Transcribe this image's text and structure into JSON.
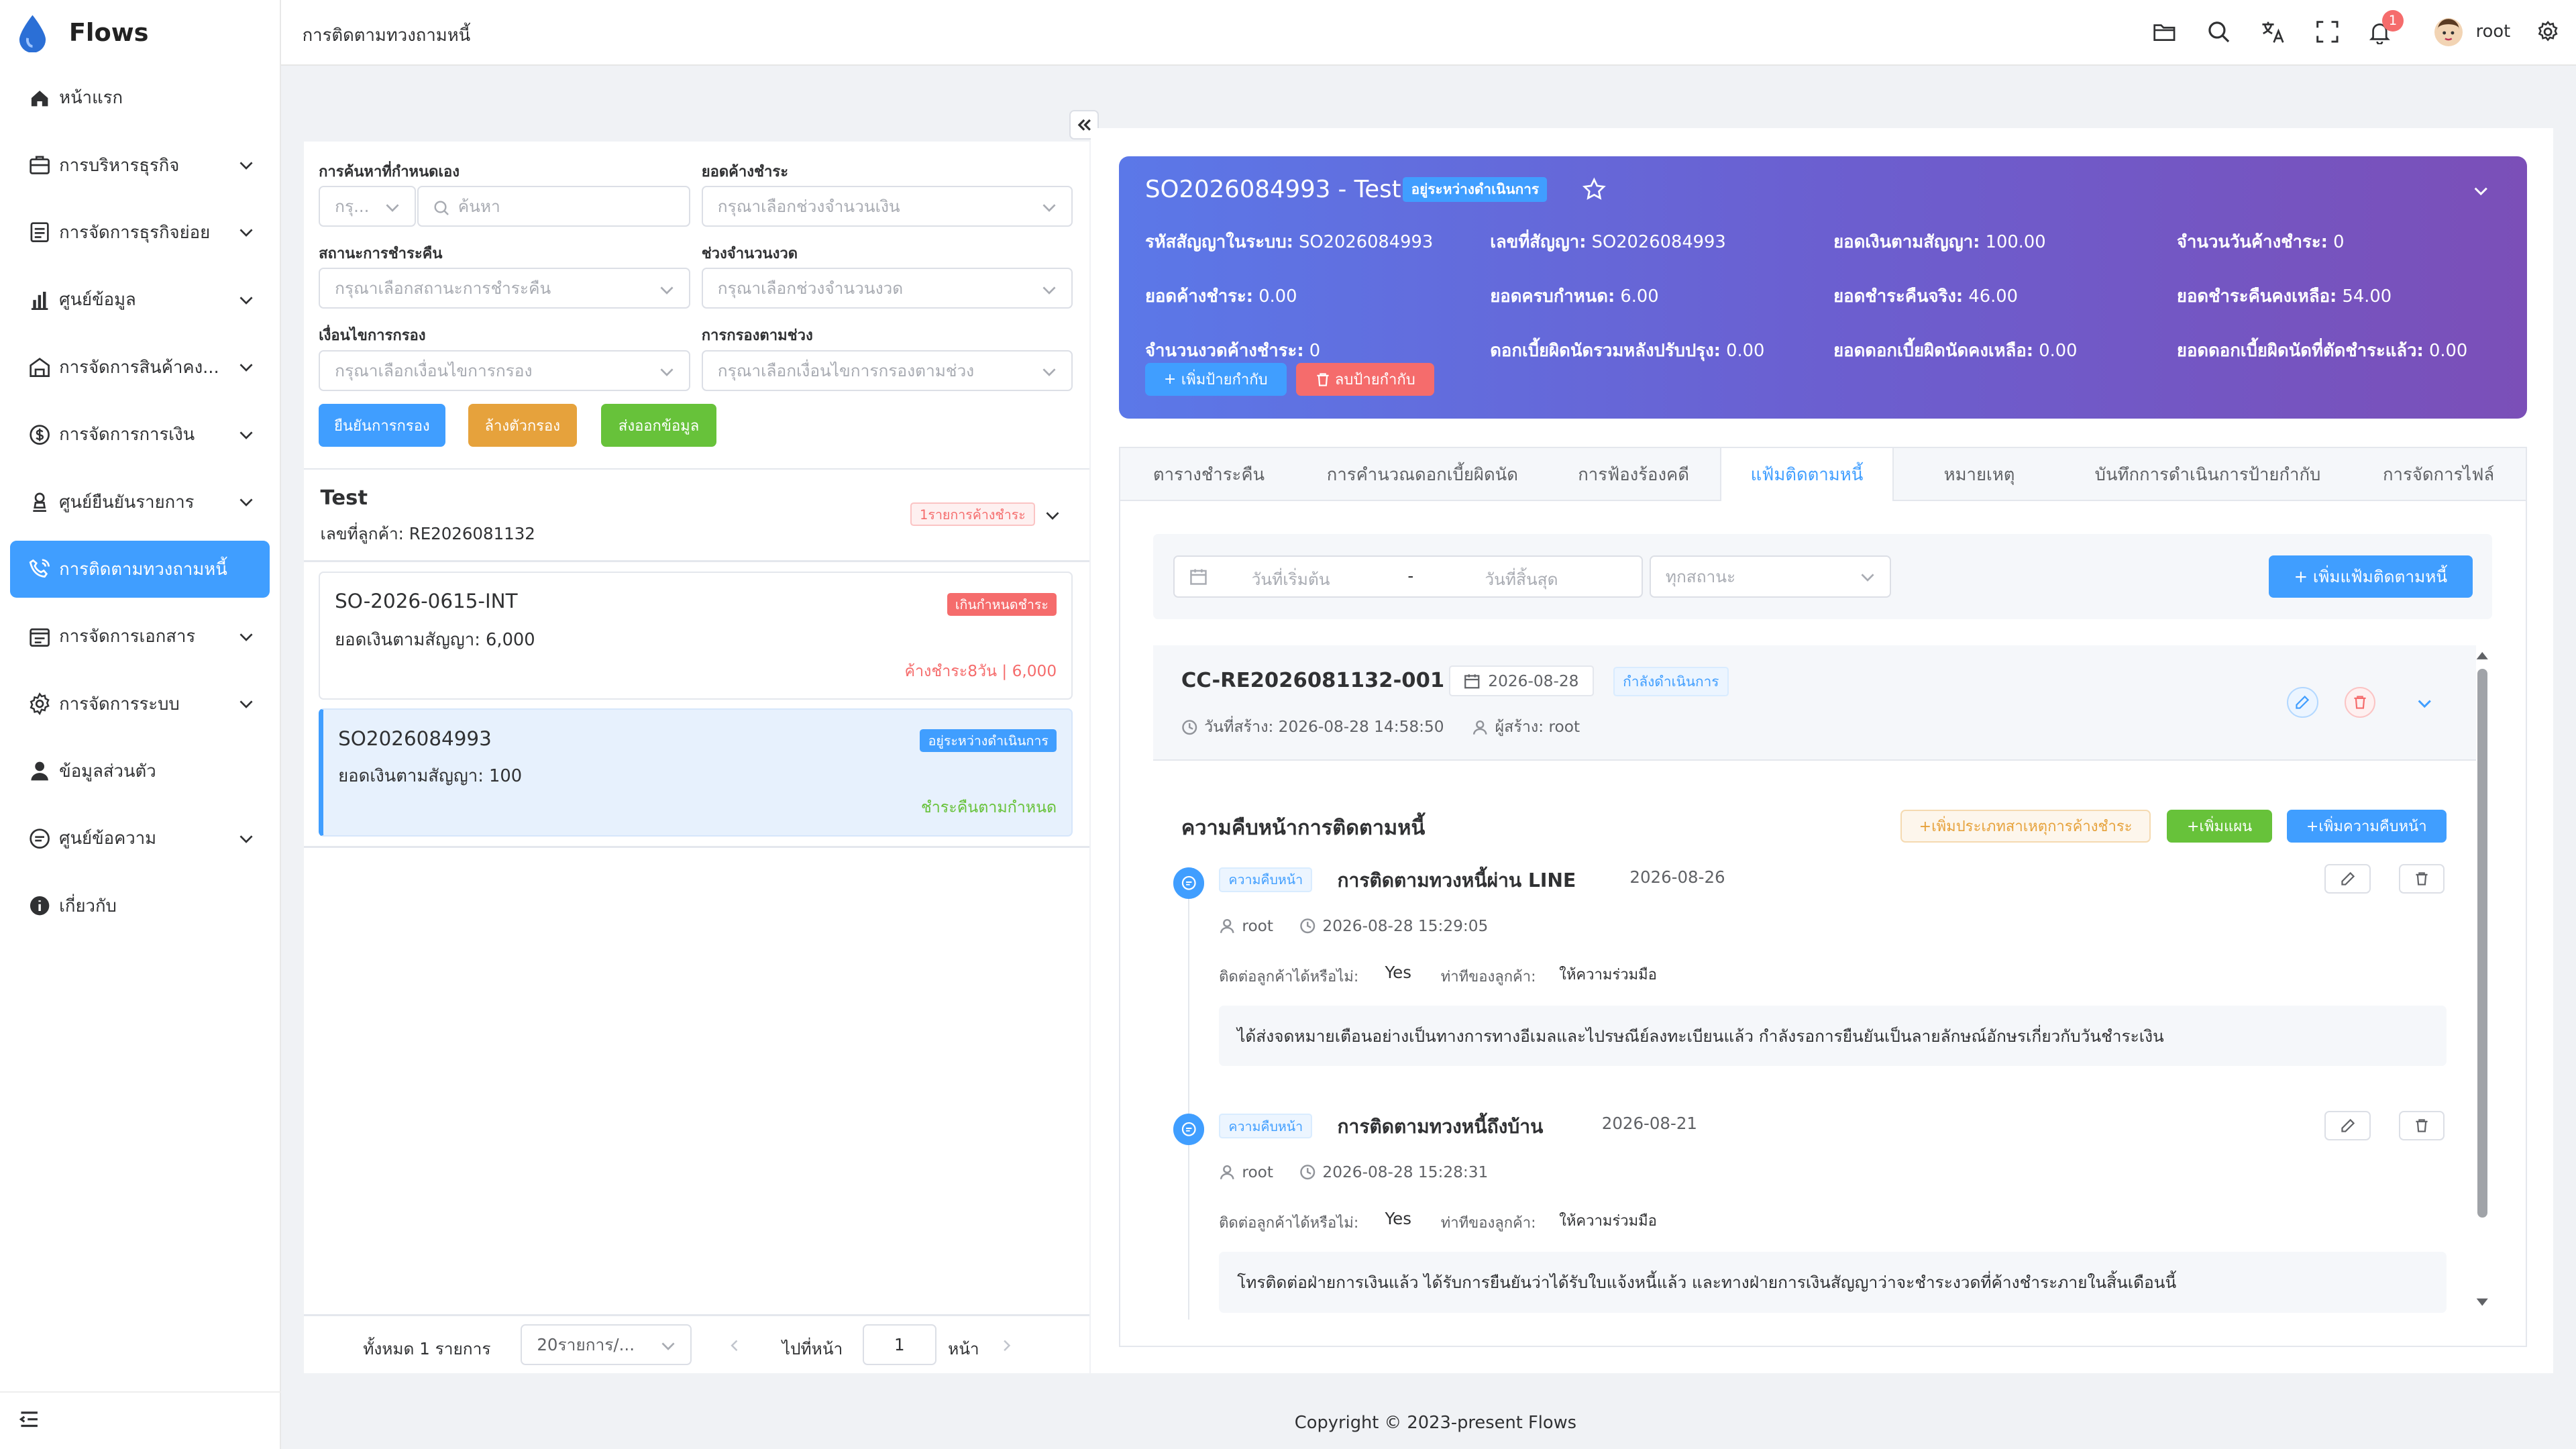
{
  "app": {
    "name": "Flows"
  },
  "sidebar": {
    "items": [
      {
        "label": "หน้าแรก",
        "icon": "home-icon"
      },
      {
        "label": "การบริหารธุรกิจ",
        "icon": "briefcase-icon",
        "expandable": true
      },
      {
        "label": "การจัดการธุรกิจย่อย",
        "icon": "document-list-icon",
        "expandable": true
      },
      {
        "label": "ศูนย์ข้อมูล",
        "icon": "bar-chart-icon",
        "expandable": true
      },
      {
        "label": "การจัดการสินค้าคง...",
        "icon": "warehouse-icon",
        "expandable": true
      },
      {
        "label": "การจัดการการเงิน",
        "icon": "money-icon",
        "expandable": true
      },
      {
        "label": "ศูนย์ยืนยันรายการ",
        "icon": "approve-icon",
        "expandable": true
      },
      {
        "label": "การติดตามทวงถามหนี้",
        "icon": "phone-call-icon",
        "active": true
      },
      {
        "label": "การจัดการเอกสาร",
        "icon": "folder-doc-icon",
        "expandable": true
      },
      {
        "label": "การจัดการระบบ",
        "icon": "gear-icon",
        "expandable": true
      },
      {
        "label": "ข้อมูลส่วนตัว",
        "icon": "user-icon"
      },
      {
        "label": "ศูนย์ข้อความ",
        "icon": "chat-icon",
        "expandable": true
      },
      {
        "label": "เกี่ยวกับ",
        "icon": "info-icon"
      }
    ]
  },
  "header": {
    "title": "การติดตามทวงถามหนี้",
    "notification_count": "1",
    "username": "root"
  },
  "filters": {
    "custom_search_label": "การค้นหาที่กำหนดเอง",
    "custom_search_type": "กรุ...",
    "search_placeholder": "ค้นหา",
    "outstanding_label": "ยอดค้างชำระ",
    "outstanding_placeholder": "กรุณาเลือกช่วงจำนวนเงิน",
    "repay_status_label": "สถานะการชำระคืน",
    "repay_status_placeholder": "กรุณาเลือกสถานะการชำระคืน",
    "installments_label": "ช่วงจำนวนงวด",
    "installments_placeholder": "กรุณาเลือกช่วงจำนวนงวด",
    "condition_label": "เงื่อนไขการกรอง",
    "condition_placeholder": "กรุณาเลือกเงื่อนไขการกรอง",
    "range_filter_label": "การกรองตามช่วง",
    "range_filter_placeholder": "กรุณาเลือกเงื่อนไขการกรองตามช่วง",
    "confirm_button": "ยืนยันการกรอง",
    "clear_button": "ล้างตัวกรอง",
    "export_button": "ส่งออกข้อมูล"
  },
  "customer": {
    "name": "Test",
    "number_line": "เลขที่ลูกค้า: RE2026081132",
    "badge": "1รายการค้างชำระ"
  },
  "contracts": [
    {
      "id": "SO-2026-0615-INT",
      "amount": "ยอดเงินตามสัญญา: 6,000",
      "status": "เกินกำหนดชำระ",
      "footer": "ค้างชำระ8วัน | 6,000"
    },
    {
      "id": "SO2026084993",
      "amount": "ยอดเงินตามสัญญา: 100",
      "status": "อยู่ระหว่างดำเนินการ",
      "footer": "ชำระคืนตามกำหนด",
      "selected": true
    }
  ],
  "pagination": {
    "total": "ทั้งหมด 1 รายการ",
    "page_size": "20รายการ/...",
    "goto_label": "ไปที่หน้า",
    "page": "1",
    "page_suffix": "หน้า"
  },
  "detail": {
    "title": "SO2026084993  - Test",
    "status": "อยู่ระหว่างดำเนินการ",
    "stats": [
      [
        "รหัสสัญญาในระบบ:",
        "SO2026084993"
      ],
      [
        "เลขที่สัญญา:",
        "SO2026084993"
      ],
      [
        "ยอดเงินตามสัญญา:",
        "100.00"
      ],
      [
        "จำนวนวันค้างชำระ:",
        "0"
      ],
      [
        "ยอดค้างชำระ:",
        "0.00"
      ],
      [
        "ยอดครบกำหนด:",
        "6.00"
      ],
      [
        "ยอดชำระคืนจริง:",
        "46.00"
      ],
      [
        "ยอดชำระคืนคงเหลือ:",
        "54.00"
      ],
      [
        "จำนวนงวดค้างชำระ:",
        "0"
      ],
      [
        "ดอกเบี้ยผิดนัดรวมหลังปรับปรุง:",
        "0.00"
      ],
      [
        "ยอดดอกเบี้ยผิดนัดคงเหลือ:",
        "0.00"
      ],
      [
        "ยอดดอกเบี้ยผิดนัดที่ตัดชำระแล้ว:",
        "0.00"
      ]
    ],
    "add_tag_button": "เพิ่มป้ายกำกับ",
    "delete_tag_button": "ลบป้ายกำกับ"
  },
  "tabs": [
    {
      "label": "ตารางชำระคืน"
    },
    {
      "label": "การคำนวณดอกเบี้ยผิดนัด"
    },
    {
      "label": "การฟ้องร้องคดี"
    },
    {
      "label": "แฟ้มติดตามหนี้",
      "active": true
    },
    {
      "label": "หมายเหตุ"
    },
    {
      "label": "บันทึกการดำเนินการป้ายกำกับ"
    },
    {
      "label": "การจัดการไฟล์"
    }
  ],
  "followup": {
    "start_date_placeholder": "วันที่เริ่มต้น",
    "date_sep": "-",
    "end_date_placeholder": "วันที่สิ้นสุด",
    "status_placeholder": "ทุกสถานะ",
    "add_file_button": "+ เพิ่มแฟ้มติดตามหนี้",
    "case": {
      "id": "CC-RE2026081132-001",
      "date": "2026-08-28",
      "status": "กำลังดำเนินการ",
      "created": "วันที่สร้าง: 2026-08-28 14:58:50",
      "creator": "ผู้สร้าง: root"
    },
    "progress_title": "ความคืบหน้าการติดตามหนี้",
    "add_reason_button": "+เพิ่มประเภทสาเหตุการค้างชำระ",
    "add_plan_button": "+เพิ่มแผน",
    "add_progress_button": "+เพิ่มความคืบหน้า",
    "entries": [
      {
        "tag": "ความคืบหน้า",
        "title": "การติดตามทวงหนี้ผ่าน LINE",
        "date": "2026-08-26",
        "user": "root",
        "time": "2026-08-28 15:29:05",
        "contact_label": "ติดต่อลูกค้าได้หรือไม่:",
        "contact_value": "Yes",
        "attitude_label": "ท่าทีของลูกค้า:",
        "attitude_value": "ให้ความร่วมมือ",
        "note": "ได้ส่งจดหมายเตือนอย่างเป็นทางการทางอีเมลและไปรษณีย์ลงทะเบียนแล้ว กำลังรอการยืนยันเป็นลายลักษณ์อักษรเกี่ยวกับวันชำระเงิน"
      },
      {
        "tag": "ความคืบหน้า",
        "title": "การติดตามทวงหนี้ถึงบ้าน",
        "date": "2026-08-21",
        "user": "root",
        "time": "2026-08-28 15:28:31",
        "contact_label": "ติดต่อลูกค้าได้หรือไม่:",
        "contact_value": "Yes",
        "attitude_label": "ท่าทีของลูกค้า:",
        "attitude_value": "ให้ความร่วมมือ",
        "note": "โทรติดต่อฝ่ายการเงินแล้ว ได้รับการยืนยันว่าได้รับใบแจ้งหนี้แล้ว และทางฝ่ายการเงินสัญญาว่าจะชำระงวดที่ค้างชำระภายในสิ้นเดือนนี้"
      }
    ]
  },
  "footer": {
    "copyright": "Copyright © 2023-present Flows"
  },
  "colors": {
    "primary": "#409eff",
    "danger": "#f56c6c",
    "warning": "#e6a23c",
    "success": "#67c23a",
    "banner_start": "#5b78e8",
    "banner_end": "#7b4fb8"
  }
}
